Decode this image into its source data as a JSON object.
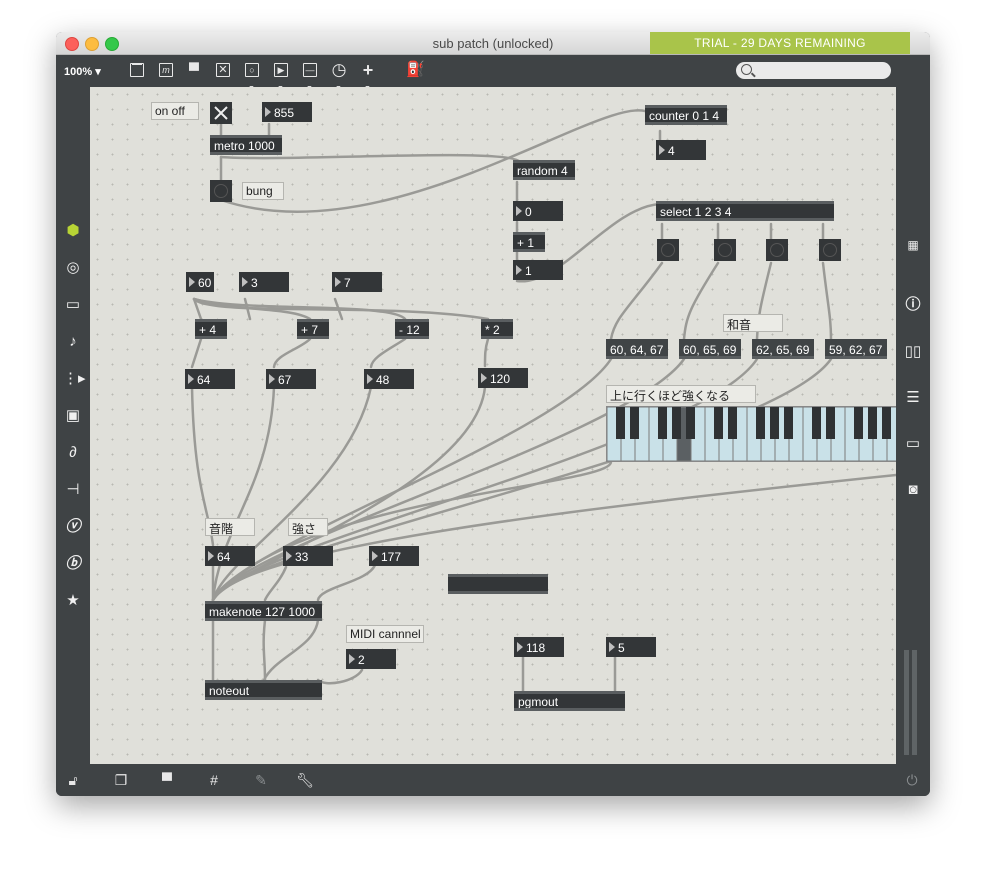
{
  "window": {
    "title": "sub patch (unlocked)",
    "trial": "TRIAL - 29 DAYS REMAINING"
  },
  "toolbar": {
    "zoom": "100%",
    "icons": [
      "presentation-icon",
      "message-icon",
      "comment-icon",
      "toggle-x-icon",
      "bang-icon",
      "play-icon",
      "number-icon",
      "dial-icon",
      "plus-icon",
      "paint-bucket-icon"
    ],
    "search_placeholder": ""
  },
  "sidebar_left": [
    "cube-icon",
    "target-icon",
    "bus-icon",
    "note-icon",
    "sequence-icon",
    "image-icon",
    "paperclip-icon",
    "plug-icon",
    "v-icon",
    "b-icon",
    "star-icon"
  ],
  "sidebar_right": [
    "grid-icon",
    "info-icon",
    "book-icon",
    "list-icon",
    "book2-icon",
    "camera-icon"
  ],
  "bottombar": [
    "lock-icon",
    "windows-icon",
    "presentation-icon",
    "grid-icon",
    "debug-icon",
    "wrench-icon",
    "power-icon"
  ],
  "patch": {
    "comments": {
      "onoff": "on off",
      "bung": "bung",
      "chord": "和音",
      "stronger": "上に行くほど強くなる",
      "scale": "音階",
      "strength": "強さ",
      "midi": "MIDI cannnel"
    },
    "objects": {
      "n855": "855",
      "metro": "metro 1000",
      "random": "random 4",
      "n0": "0",
      "plus1": "+ 1",
      "n1": "1",
      "counter": "counter 0 1 4",
      "n4": "4",
      "select": "select 1 2 3 4",
      "m1": "60, 64, 67",
      "m2": "60, 65, 69",
      "m3": "62, 65, 69",
      "m4": "59, 62, 67",
      "n60": "60",
      "n3": "3",
      "n7": "7",
      "add4": "+ 4",
      "add7": "+ 7",
      "sub12": "- 12",
      "mul2": "* 2",
      "n64": "64",
      "n67": "67",
      "n48": "48",
      "n120": "120",
      "vel64": "64",
      "vel33": "33",
      "dur177": "177",
      "makenote": "makenote 127 1000",
      "ch2": "2",
      "noteout": "noteout",
      "p118": "118",
      "p5": "5",
      "pgmout": "pgmout"
    }
  }
}
